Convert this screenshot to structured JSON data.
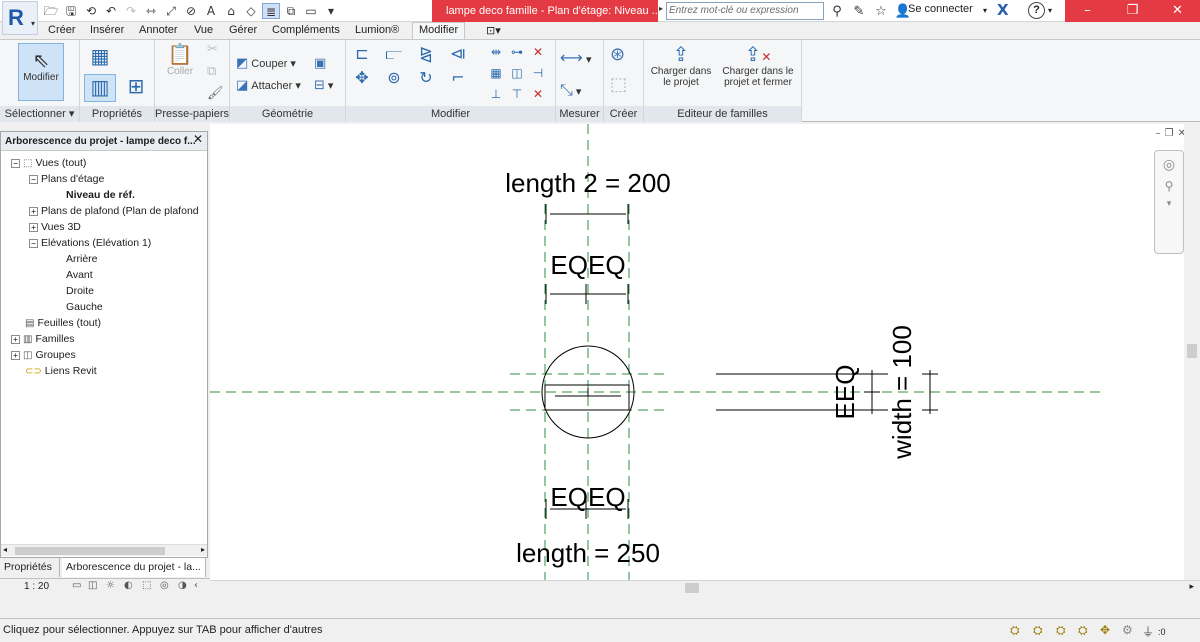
{
  "titlebar": {
    "app_letter": "R",
    "document_title": "lampe deco famille - Plan d'étage: Niveau ...",
    "search_placeholder": "Entrez mot-clé ou expression",
    "signin_label": "Se connecter",
    "help_label": "?",
    "window_controls": [
      "–",
      "❐",
      "✕"
    ]
  },
  "ribbon_tabs": [
    "Créer",
    "Insérer",
    "Annoter",
    "Vue",
    "Gérer",
    "Compléments",
    "Lumion®",
    "Modifier"
  ],
  "ribbon": {
    "select_button": "Modifier",
    "panels": {
      "select": "Sélectionner ▾",
      "properties": "Propriétés",
      "clipboard": "Presse-papiers",
      "geometry": "Géométrie",
      "modify": "Modifier",
      "measure": "Mesurer",
      "create": "Créer",
      "family_editor": "Editeur de familles"
    },
    "paste_label": "Coller",
    "cut_label": "Couper",
    "join_label": "Attacher",
    "load_into_project": "Charger dans le projet",
    "load_into_project_close": "Charger dans le projet et fermer"
  },
  "browser": {
    "title": "Arborescence du projet - lampe deco f...",
    "tree": [
      {
        "label": "Vues (tout)",
        "toggle": "−",
        "icon": "views-icon"
      },
      {
        "label": "Plans d'étage",
        "toggle": "−"
      },
      {
        "label": "Niveau de réf.",
        "bold": true
      },
      {
        "label": "Plans de plafond (Plan de plafond",
        "toggle": "+"
      },
      {
        "label": "Vues 3D",
        "toggle": "+"
      },
      {
        "label": "Elévations (Elévation 1)",
        "toggle": "−"
      },
      {
        "label": "Arrière"
      },
      {
        "label": "Avant"
      },
      {
        "label": "Droite"
      },
      {
        "label": "Gauche"
      },
      {
        "label": "Feuilles (tout)",
        "icon": "sheets-icon"
      },
      {
        "label": "Familles",
        "toggle": "+",
        "icon": "families-icon"
      },
      {
        "label": "Groupes",
        "toggle": "+",
        "icon": "groups-icon"
      },
      {
        "label": "Liens Revit",
        "icon": "links-icon"
      }
    ],
    "tabs": [
      "Propriétés",
      "Arborescence du projet - la..."
    ]
  },
  "canvas": {
    "labels": {
      "length2": "length 2 = 200",
      "eq_top": "EQEQ",
      "eq_bottom": "EQEQ",
      "length": "length = 250",
      "eq_right": "EEQ",
      "width": "width = 100"
    }
  },
  "viewbar": {
    "scale": "1 : 20"
  },
  "statusbar": {
    "message": "Cliquez pour sélectionner. Appuyez sur TAB pour afficher d'autres",
    "filter_count": ":0"
  }
}
